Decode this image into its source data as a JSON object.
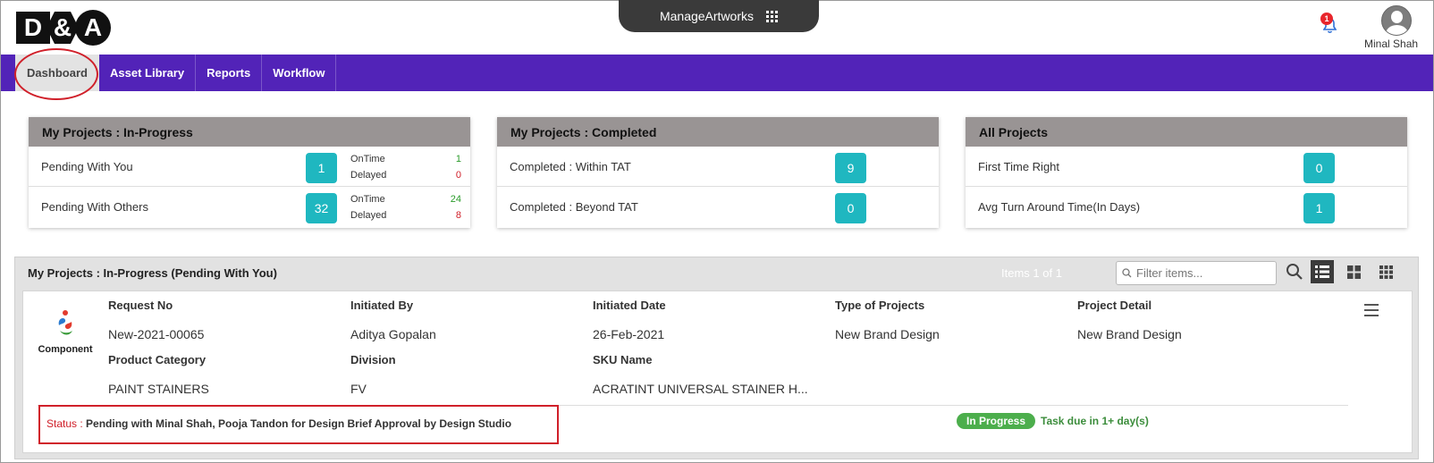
{
  "header": {
    "logo": {
      "left": "D",
      "middle": "&",
      "right": "A"
    },
    "app_switcher_label": "ManageArtworks",
    "notification_count": "1",
    "user_name": "Minal Shah"
  },
  "nav": {
    "items": [
      {
        "label": "Dashboard",
        "active": true
      },
      {
        "label": "Asset Library",
        "active": false
      },
      {
        "label": "Reports",
        "active": false
      },
      {
        "label": "Workflow",
        "active": false
      }
    ]
  },
  "cards": {
    "in_progress": {
      "title": "My Projects : In-Progress",
      "rows": [
        {
          "label": "Pending With You",
          "count": "1",
          "ontime_label": "OnTime",
          "ontime": "1",
          "delayed_label": "Delayed",
          "delayed": "0"
        },
        {
          "label": "Pending With Others",
          "count": "32",
          "ontime_label": "OnTime",
          "ontime": "24",
          "delayed_label": "Delayed",
          "delayed": "8"
        }
      ]
    },
    "completed": {
      "title": "My Projects : Completed",
      "rows": [
        {
          "label": "Completed : Within TAT",
          "count": "9"
        },
        {
          "label": "Completed : Beyond TAT",
          "count": "0"
        }
      ]
    },
    "all": {
      "title": "All Projects",
      "rows": [
        {
          "label": "First Time Right",
          "count": "0"
        },
        {
          "label": "Avg Turn Around Time(In Days)",
          "count": "1"
        }
      ]
    }
  },
  "panel": {
    "title": "My Projects : In-Progress (Pending With You)",
    "items_count": "Items 1 of 1",
    "filter_placeholder": "Filter items..."
  },
  "project": {
    "logo_text": "Component",
    "fields": {
      "request_no": {
        "label": "Request No",
        "value": "New-2021-00065"
      },
      "initiated_by": {
        "label": "Initiated By",
        "value": "Aditya Gopalan"
      },
      "initiated_date": {
        "label": "Initiated Date",
        "value": "26-Feb-2021"
      },
      "type_of_projects": {
        "label": "Type of Projects",
        "value": "New Brand Design"
      },
      "project_detail": {
        "label": "Project Detail",
        "value": "New Brand Design"
      },
      "product_category": {
        "label": "Product Category",
        "value": "PAINT STAINERS"
      },
      "division": {
        "label": "Division",
        "value": "FV"
      },
      "sku_name": {
        "label": "SKU Name",
        "value": "ACRATINT UNIVERSAL STAINER H..."
      }
    },
    "status_label": "Status :",
    "status_value": "Pending with Minal Shah, Pooja Tandon for Design Brief Approval by Design Studio",
    "state_badge": "In Progress",
    "due_text": "Task due in 1+ day(s)"
  },
  "colors": {
    "nav_bg": "#5223b8",
    "count_badge": "#1fb7c0",
    "card_header": "#999494",
    "annotation": "#d0202a",
    "in_progress": "#4cae4c"
  }
}
